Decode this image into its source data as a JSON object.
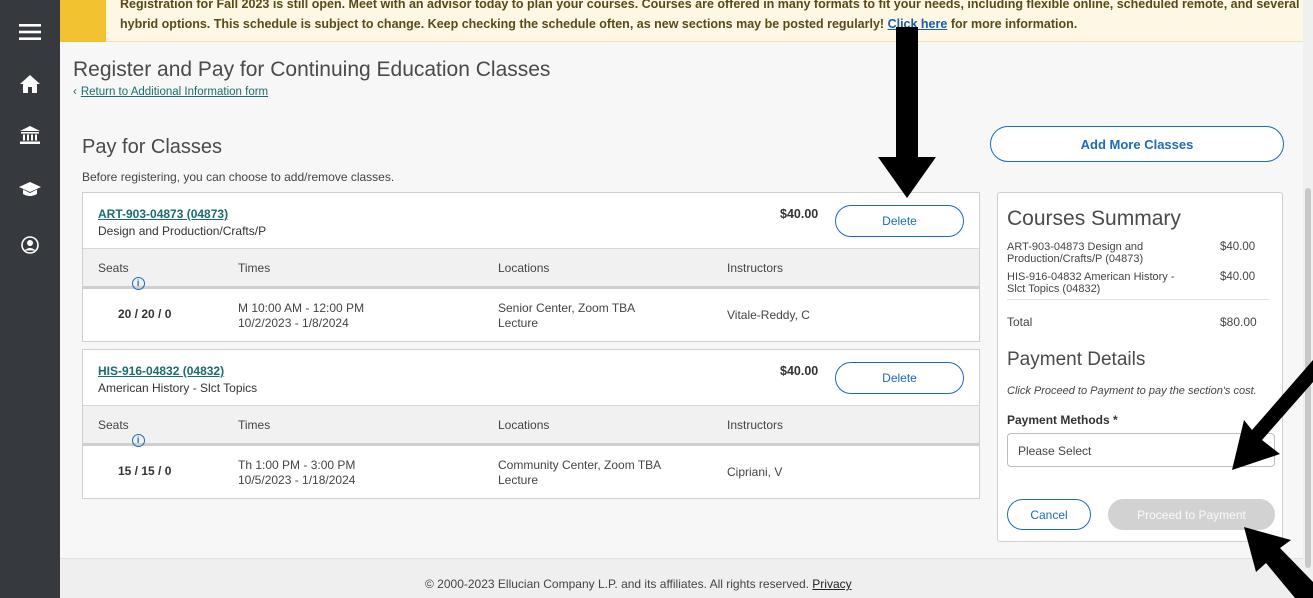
{
  "banner": {
    "line1": "Registration for Fall 2023 is still open. Meet with an advisor today to plan your courses. Courses are offered in many formats to fit your needs, including flexible online, scheduled remote, and several",
    "line2_prefix": "hybrid options. This schedule is subject to change. Keep checking the schedule often, as new sections may be posted regularly!",
    "line2_link": "Click here",
    "line2_suffix": "for more information."
  },
  "nav": {
    "items": [
      {
        "icon": "menu-icon"
      },
      {
        "icon": "home-icon"
      },
      {
        "icon": "bank-icon"
      },
      {
        "icon": "graduation-cap-icon"
      },
      {
        "icon": "user-circle-icon"
      }
    ]
  },
  "page": {
    "title": "Register and Pay for Continuing Education Classes",
    "back_link": "Return to Additional Information form",
    "pay_title": "Pay for Classes",
    "pay_subtitle": "Before registering, you can choose to add/remove classes."
  },
  "columns": {
    "seats": "Seats",
    "times": "Times",
    "locations": "Locations",
    "instructors": "Instructors"
  },
  "sections": [
    {
      "code": "ART-903-04873 (04873)",
      "name": "Design and Production/Crafts/P",
      "price": "$40.00",
      "delete_label": "Delete",
      "seats": "20 / 20 / 0",
      "time_line1": "M 10:00 AM - 12:00 PM",
      "time_line2": "10/2/2023 - 1/8/2024",
      "location_line1": "Senior Center, Zoom TBA",
      "location_line2": "Lecture",
      "instructor": "Vitale-Reddy, C"
    },
    {
      "code": "HIS-916-04832 (04832)",
      "name": "American History - Slct Topics",
      "price": "$40.00",
      "delete_label": "Delete",
      "seats": "15 / 15 / 0",
      "time_line1": "Th 1:00 PM - 3:00 PM",
      "time_line2": "10/5/2023 - 1/18/2024",
      "location_line1": "Community Center, Zoom TBA",
      "location_line2": "Lecture",
      "instructor": "Cipriani, V"
    }
  ],
  "summary": {
    "add_more_label": "Add More Classes",
    "title": "Courses Summary",
    "items": [
      {
        "label": "ART-903-04873 Design and Production/Crafts/P (04873)",
        "price": "$40.00"
      },
      {
        "label": "HIS-916-04832 American History - Slct Topics (04832)",
        "price": "$40.00"
      }
    ],
    "total_label": "Total",
    "total_value": "$80.00",
    "payment_title": "Payment Details",
    "payment_note": "Click Proceed to Payment to pay the section's cost.",
    "payment_methods_label": "Payment Methods *",
    "payment_methods_value": "Please Select",
    "cancel_label": "Cancel",
    "proceed_label": "Proceed to Payment"
  },
  "footer": {
    "text": "© 2000-2023 Ellucian Company L.P. and its affiliates. All rights reserved.",
    "privacy_label": "Privacy"
  },
  "colors": {
    "rail": "#36393d",
    "banner_stripe": "#f2c230",
    "link": "#1b6b6f",
    "button_blue": "#1b6bb8",
    "disabled_button": "#d2d2d2"
  }
}
